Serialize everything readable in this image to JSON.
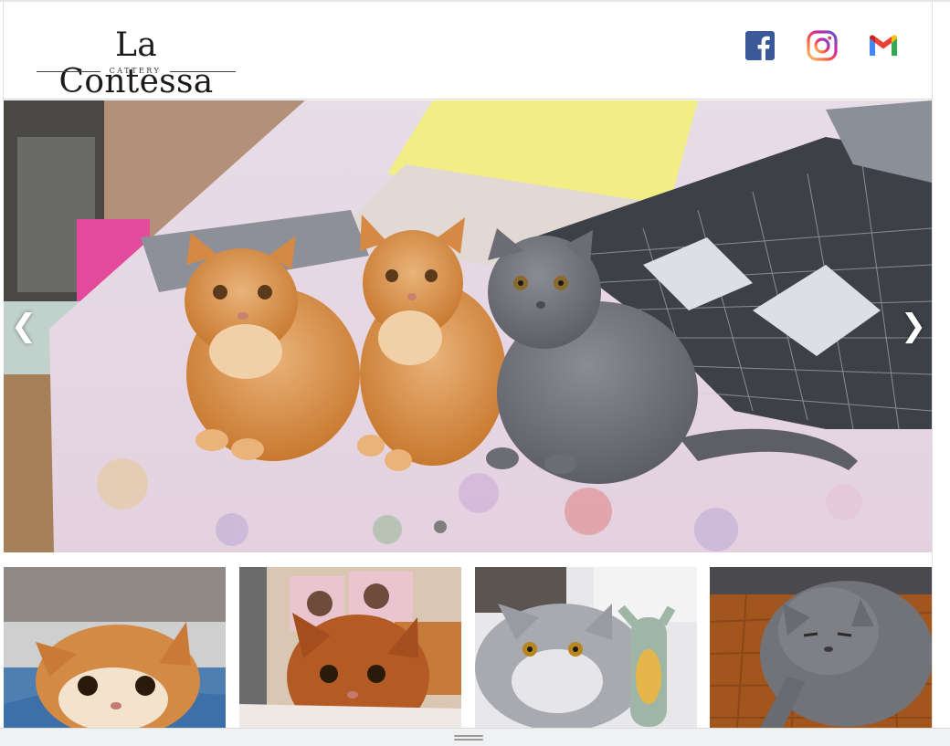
{
  "brand": {
    "title": "La Contessa",
    "subtitle": "CATTERY"
  },
  "social": [
    {
      "name": "facebook",
      "icon": "facebook-icon",
      "color": "#3b5998"
    },
    {
      "name": "instagram",
      "icon": "instagram-icon",
      "color": "#d6249f"
    },
    {
      "name": "gmail",
      "icon": "gmail-icon",
      "color": "#ea4335"
    }
  ],
  "carousel": {
    "prev_label": "❮",
    "next_label": "❯",
    "slide_count": 1,
    "active_slide": 1,
    "slide": "three exotic shorthair kittens (two cream-orange, one grey) on a floral bedsheet"
  },
  "thumbnails": [
    {
      "icon": "orange-kitten-photo"
    },
    {
      "icon": "red-exotic-kitten-photo"
    },
    {
      "icon": "silver-exotic-kitten-photo"
    },
    {
      "icon": "grey-exotic-cat-photo"
    }
  ],
  "colors": {
    "header_bg": "#ffffff",
    "bottom_bar": "#f0f1f2",
    "dot": "#6d6d6d"
  }
}
